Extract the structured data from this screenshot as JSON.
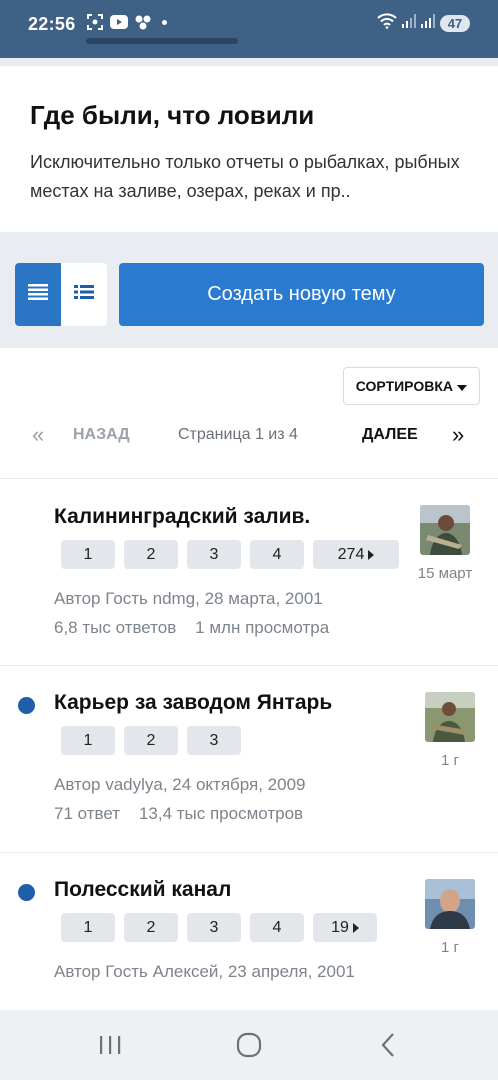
{
  "status": {
    "time": "22:56",
    "battery": "47",
    "icons_left": [
      "screenshot-icon",
      "youtube-icon",
      "apps-icon"
    ],
    "icons_right": [
      "wifi-icon",
      "signal-icon",
      "signal-icon"
    ]
  },
  "forum": {
    "title": "Где были, что ловили",
    "description": "Исключительно только отчеты о рыбалках, рыбных местах на заливе, озерах, реках и пр.."
  },
  "actions": {
    "create_label": "Создать новую тему",
    "view_modes": [
      "list-dense-icon",
      "list-icon"
    ]
  },
  "toolbar": {
    "sort_label": "СОРТИРОВКА",
    "prev_label": "НАЗАД",
    "page_info": "Страница 1 из 4",
    "next_label": "ДАЛЕЕ"
  },
  "topics": [
    {
      "title": "Калининградский залив.",
      "unread": false,
      "pages": [
        "1",
        "2",
        "3",
        "4",
        "274"
      ],
      "author_line": "Автор Гость ndmg, 28 марта, 2001",
      "replies": "6,8 тыс ответов",
      "views": "1 млн просмотра",
      "last_post": "15 март"
    },
    {
      "title": "Карьер за заводом Янтарь",
      "unread": true,
      "pages": [
        "1",
        "2",
        "3"
      ],
      "author_line": "Автор vadylya, 24 октября, 2009",
      "replies": "71 ответ",
      "views": "13,4 тыс просмотров",
      "last_post": "1 г"
    },
    {
      "title": "Полесский канал",
      "unread": true,
      "pages": [
        "1",
        "2",
        "3",
        "4",
        "19"
      ],
      "author_line": "Автор Гость Алексей, 23 апреля, 2001",
      "last_post": "1 г"
    }
  ],
  "colors": {
    "statusbar": "#3f6186",
    "accent": "#2a7ad0",
    "unread_dot": "#1e5fa8"
  }
}
